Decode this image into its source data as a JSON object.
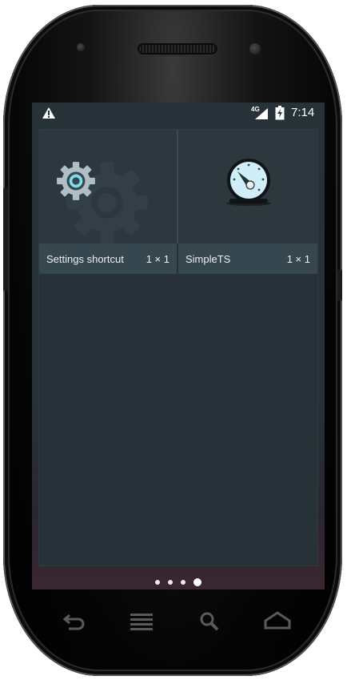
{
  "device": {
    "name": "Nexus S style phone"
  },
  "status_bar": {
    "warning_icon": "warning-triangle-icon",
    "network_label": "4G",
    "signal_icon": "signal-icon",
    "battery_icon": "battery-charging-icon",
    "time": "7:14"
  },
  "widgets": [
    {
      "name": "Settings shortcut",
      "size": "1 × 1",
      "icon": "gear-icon"
    },
    {
      "name": "SimpleTS",
      "size": "1 × 1",
      "icon": "gauge-icon"
    }
  ],
  "pager": {
    "pages": 4,
    "current_page": 4
  },
  "nav_keys": [
    "back-key-icon",
    "menu-key-icon",
    "search-key-icon",
    "home-key-icon"
  ],
  "colors": {
    "background": "#263238",
    "label_bar": "#37474f",
    "accent": "#80deea"
  }
}
